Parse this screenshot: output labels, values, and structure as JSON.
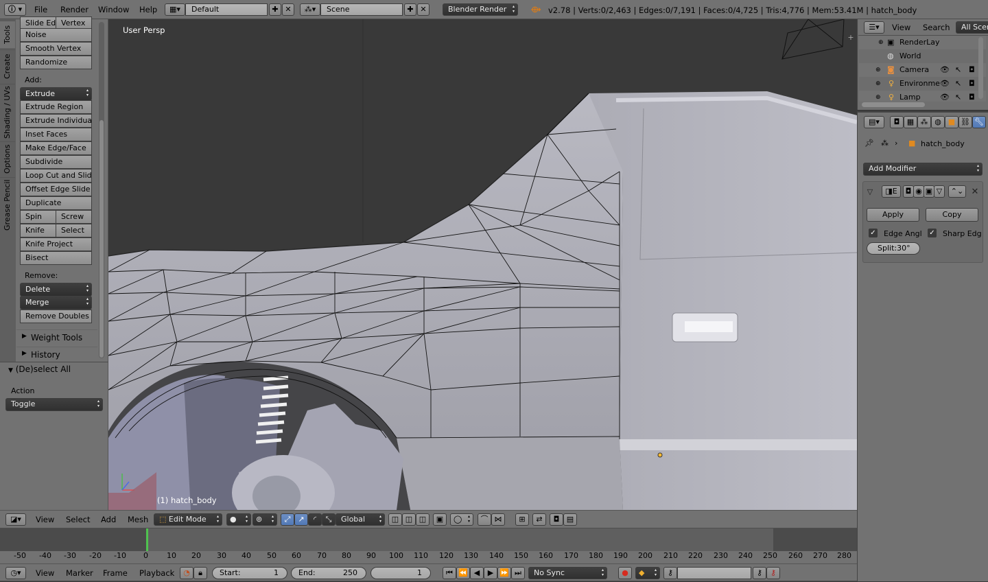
{
  "topbar": {
    "menus": [
      "File",
      "Render",
      "Window",
      "Help"
    ],
    "layout": "Default",
    "scene": "Scene",
    "engine": "Blender Render",
    "stats": "v2.78 | Verts:0/2,463 | Edges:0/7,191 | Faces:0/4,725 | Tris:4,776 | Mem:53.41M | hatch_body"
  },
  "toolshelf": {
    "tabs": [
      "Tools",
      "Create",
      "Shading / UVs",
      "Options",
      "Grease Pencil"
    ],
    "top_buttons": [
      "Slide Ed",
      "Vertex",
      "Noise",
      "Smooth Vertex",
      "Randomize"
    ],
    "add_label": "Add:",
    "extrude": "Extrude",
    "add_buttons": [
      "Extrude Region",
      "Extrude Individual",
      "Inset Faces",
      "Make Edge/Face",
      "Subdivide",
      "Loop Cut and Slide",
      "Offset Edge Slide",
      "Duplicate"
    ],
    "spin": "Spin",
    "screw": "Screw",
    "knife": "Knife",
    "select": "Select",
    "knife_project": "Knife Project",
    "bisect": "Bisect",
    "remove_label": "Remove:",
    "delete": "Delete",
    "merge": "Merge",
    "remove_doubles": "Remove Doubles",
    "weight_tools": "Weight Tools",
    "history": "History"
  },
  "operator": {
    "title": "(De)select All",
    "action_label": "Action",
    "action_value": "Toggle"
  },
  "viewport": {
    "view_name": "User Persp",
    "object_label": "(1) hatch_body"
  },
  "view3d_header": {
    "menus": [
      "View",
      "Select",
      "Add",
      "Mesh"
    ],
    "mode": "Edit Mode",
    "orientation": "Global"
  },
  "outliner": {
    "menus": [
      "View",
      "Search"
    ],
    "scope": "All Scen",
    "items": [
      "RenderLay",
      "World",
      "Camera",
      "Environme",
      "Lamp"
    ]
  },
  "properties": {
    "object": "hatch_body",
    "add_modifier": "Add Modifier",
    "apply": "Apply",
    "copy": "Copy",
    "edge_angle": "Edge Angl",
    "sharp_edges": "Sharp Edg",
    "split": "Split:30°"
  },
  "timeline": {
    "ruler": [
      "-50",
      "-40",
      "-30",
      "-20",
      "-10",
      "0",
      "10",
      "20",
      "30",
      "40",
      "50",
      "60",
      "70",
      "80",
      "90",
      "100",
      "110",
      "120",
      "130",
      "140",
      "150",
      "160",
      "170",
      "180",
      "190",
      "200",
      "210",
      "220",
      "230",
      "240",
      "250",
      "260",
      "270",
      "280"
    ],
    "menus": [
      "View",
      "Marker",
      "Frame",
      "Playback"
    ],
    "start": "Start:",
    "start_value": "1",
    "end": "End:",
    "end_value": "250",
    "current": "1",
    "sync": "No Sync"
  }
}
